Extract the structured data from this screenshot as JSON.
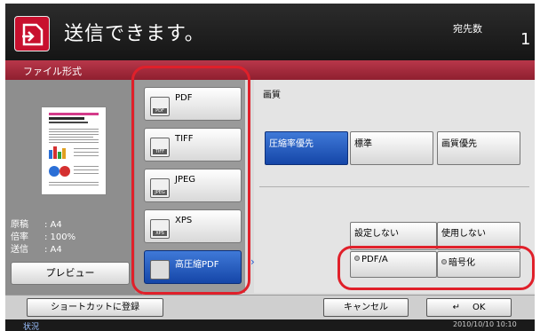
{
  "header": {
    "title": "送信できます。",
    "destination_label": "宛先数",
    "destination_count": "1"
  },
  "section": {
    "title": "ファイル形式"
  },
  "preview": {
    "document": {
      "label": "原稿",
      "value": ": A4"
    },
    "zoom": {
      "label": "倍率",
      "value": ": 100%"
    },
    "send": {
      "label": "送信",
      "value": ": A4"
    },
    "button_label": "プレビュー"
  },
  "formats": [
    {
      "label": "PDF",
      "icon": "pdf-file-icon",
      "icon_tag": "PDF",
      "selected": false
    },
    {
      "label": "TIFF",
      "icon": "tiff-file-icon",
      "icon_tag": "TIFF",
      "selected": false
    },
    {
      "label": "JPEG",
      "icon": "jpeg-file-icon",
      "icon_tag": "JPEG",
      "selected": false
    },
    {
      "label": "XPS",
      "icon": "xps-file-icon",
      "icon_tag": "XPS",
      "selected": false
    },
    {
      "label": "高圧縮PDF",
      "icon": "high-compression-pdf-icon",
      "icon_tag": "",
      "selected": true
    }
  ],
  "quality": {
    "title": "画質",
    "options": [
      {
        "label": "圧縮率優先",
        "selected": true
      },
      {
        "label": "標準",
        "selected": false
      },
      {
        "label": "画質優先",
        "selected": false
      }
    ]
  },
  "pdf_options": {
    "none_label": "設定しない",
    "use_label": "使用しない",
    "pdfa_label": "PDF/A",
    "encrypt_label": "暗号化"
  },
  "bottom": {
    "shortcut_label": "ショートカットに登録",
    "cancel_label": "キャンセル",
    "ok_label": "OK",
    "status": "状況",
    "datetime": "2010/10/10   10:10"
  },
  "colors": {
    "accent_red": "#c8102e",
    "selected_blue": "#1f55c0",
    "callout_red": "#e0202a"
  }
}
